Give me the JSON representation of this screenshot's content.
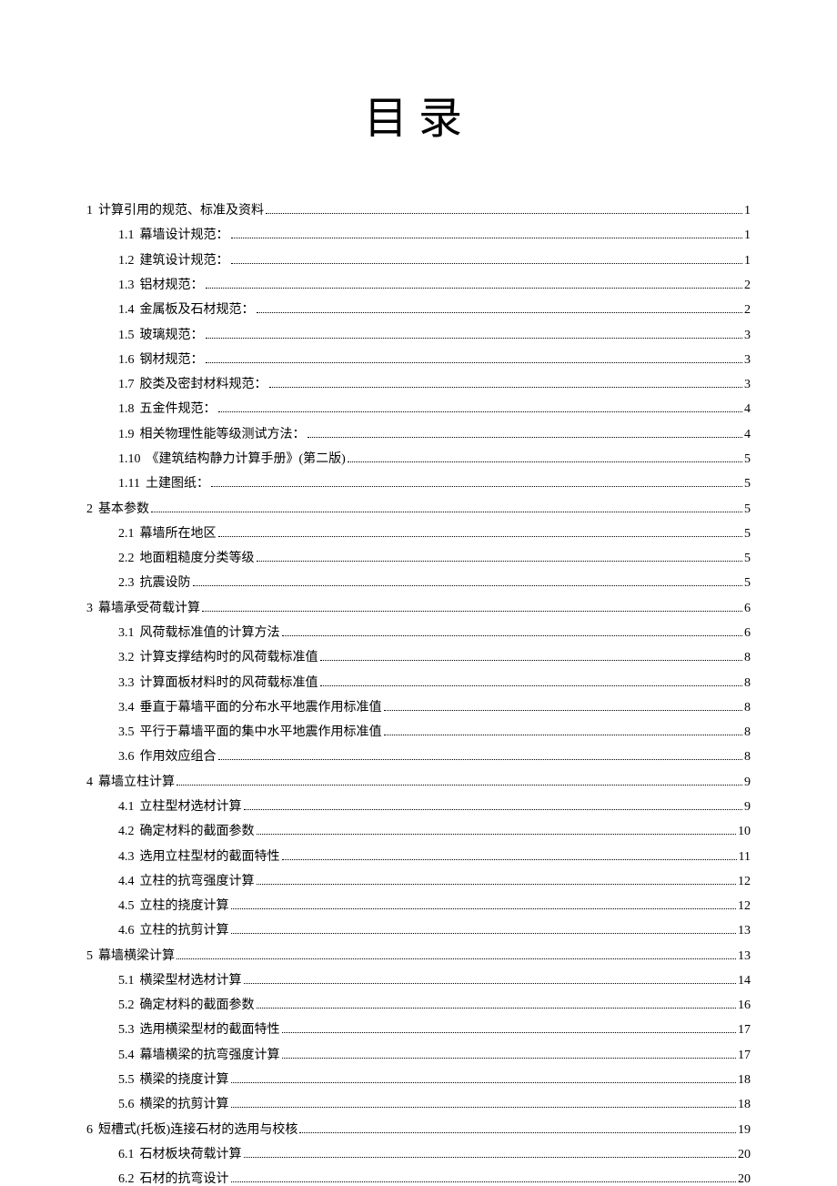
{
  "title": "目录",
  "entries": [
    {
      "level": 1,
      "num": "1",
      "text": "计算引用的规范、标准及资料",
      "page": "1"
    },
    {
      "level": 2,
      "num": "1.1",
      "text": "幕墙设计规范：",
      "page": "1"
    },
    {
      "level": 2,
      "num": "1.2",
      "text": "建筑设计规范：",
      "page": "1"
    },
    {
      "level": 2,
      "num": "1.3",
      "text": "铝材规范：",
      "page": "2"
    },
    {
      "level": 2,
      "num": "1.4",
      "text": "金属板及石材规范：",
      "page": "2"
    },
    {
      "level": 2,
      "num": "1.5",
      "text": "玻璃规范：",
      "page": "3"
    },
    {
      "level": 2,
      "num": "1.6",
      "text": "钢材规范：",
      "page": "3"
    },
    {
      "level": 2,
      "num": "1.7",
      "text": "胶类及密封材料规范：",
      "page": "3"
    },
    {
      "level": 2,
      "num": "1.8",
      "text": "五金件规范：",
      "page": "4"
    },
    {
      "level": 2,
      "num": "1.9",
      "text": "相关物理性能等级测试方法：",
      "page": "4"
    },
    {
      "level": 2,
      "num": "1.10",
      "text": "《建筑结构静力计算手册》(第二版)",
      "page": "5"
    },
    {
      "level": 2,
      "num": "1.11",
      "text": "土建图纸：",
      "page": "5"
    },
    {
      "level": 1,
      "num": "2",
      "text": "基本参数",
      "page": "5"
    },
    {
      "level": 2,
      "num": "2.1",
      "text": "幕墙所在地区",
      "page": "5"
    },
    {
      "level": 2,
      "num": "2.2",
      "text": "地面粗糙度分类等级",
      "page": "5"
    },
    {
      "level": 2,
      "num": "2.3",
      "text": "抗震设防",
      "page": "5"
    },
    {
      "level": 1,
      "num": "3",
      "text": "幕墙承受荷载计算",
      "page": "6"
    },
    {
      "level": 2,
      "num": "3.1",
      "text": "风荷载标准值的计算方法",
      "page": "6"
    },
    {
      "level": 2,
      "num": "3.2",
      "text": "计算支撑结构时的风荷载标准值",
      "page": "8"
    },
    {
      "level": 2,
      "num": "3.3",
      "text": "计算面板材料时的风荷载标准值",
      "page": "8"
    },
    {
      "level": 2,
      "num": "3.4",
      "text": "垂直于幕墙平面的分布水平地震作用标准值",
      "page": "8"
    },
    {
      "level": 2,
      "num": "3.5",
      "text": "平行于幕墙平面的集中水平地震作用标准值",
      "page": "8"
    },
    {
      "level": 2,
      "num": "3.6",
      "text": "作用效应组合",
      "page": "8"
    },
    {
      "level": 1,
      "num": "4",
      "text": "幕墙立柱计算",
      "page": "9"
    },
    {
      "level": 2,
      "num": "4.1",
      "text": "立柱型材选材计算",
      "page": "9"
    },
    {
      "level": 2,
      "num": "4.2",
      "text": "确定材料的截面参数",
      "page": "10"
    },
    {
      "level": 2,
      "num": "4.3",
      "text": "选用立柱型材的截面特性",
      "page": "11"
    },
    {
      "level": 2,
      "num": "4.4",
      "text": "立柱的抗弯强度计算",
      "page": "12"
    },
    {
      "level": 2,
      "num": "4.5",
      "text": "立柱的挠度计算",
      "page": "12"
    },
    {
      "level": 2,
      "num": "4.6",
      "text": "立柱的抗剪计算",
      "page": "13"
    },
    {
      "level": 1,
      "num": "5",
      "text": "幕墙横梁计算",
      "page": "13"
    },
    {
      "level": 2,
      "num": "5.1",
      "text": "横梁型材选材计算",
      "page": "14"
    },
    {
      "level": 2,
      "num": "5.2",
      "text": "确定材料的截面参数",
      "page": "16"
    },
    {
      "level": 2,
      "num": "5.3",
      "text": "选用横梁型材的截面特性",
      "page": "17"
    },
    {
      "level": 2,
      "num": "5.4",
      "text": "幕墙横梁的抗弯强度计算",
      "page": "17"
    },
    {
      "level": 2,
      "num": "5.5",
      "text": "横梁的挠度计算",
      "page": "18"
    },
    {
      "level": 2,
      "num": "5.6",
      "text": "横梁的抗剪计算",
      "page": "18"
    },
    {
      "level": 1,
      "num": "6",
      "text": "短槽式(托板)连接石材的选用与校核",
      "page": "19"
    },
    {
      "level": 2,
      "num": "6.1",
      "text": "石材板块荷载计算",
      "page": "20"
    },
    {
      "level": 2,
      "num": "6.2",
      "text": "石材的抗弯设计",
      "page": "20"
    }
  ]
}
